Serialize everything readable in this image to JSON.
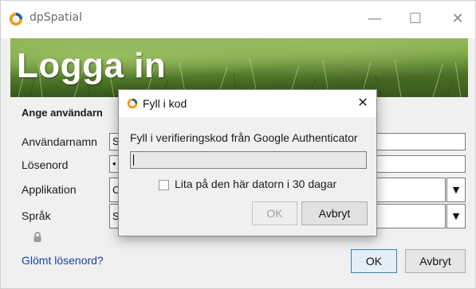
{
  "window": {
    "title": "dpSpatial",
    "controls": {
      "minimize": "—",
      "maximize": "☐",
      "close": "✕"
    }
  },
  "banner": {
    "title": "Logga in"
  },
  "form": {
    "heading": "Ange användarn",
    "username_label": "Användarnamn",
    "username_value": "S",
    "password_label": "Lösenord",
    "password_value": "•",
    "application_label": "Applikation",
    "application_value": "C",
    "language_label": "Språk",
    "language_value": "S",
    "forgot_link": "Glömt lösenord?",
    "ok_label": "OK",
    "cancel_label": "Avbryt"
  },
  "dialog": {
    "title": "Fyll i kod",
    "close": "✕",
    "prompt": "Fyll i verifieringskod från Google Authenticator",
    "code_value": "",
    "trust_label": "Lita på den här datorn i 30 dagar",
    "trust_checked": false,
    "ok_label": "OK",
    "cancel_label": "Avbryt"
  },
  "colors": {
    "link": "#1a3fa8",
    "ok_border": "#3c7fb1",
    "brand_orange": "#f39a1e",
    "brand_blue": "#1f5fa8"
  }
}
